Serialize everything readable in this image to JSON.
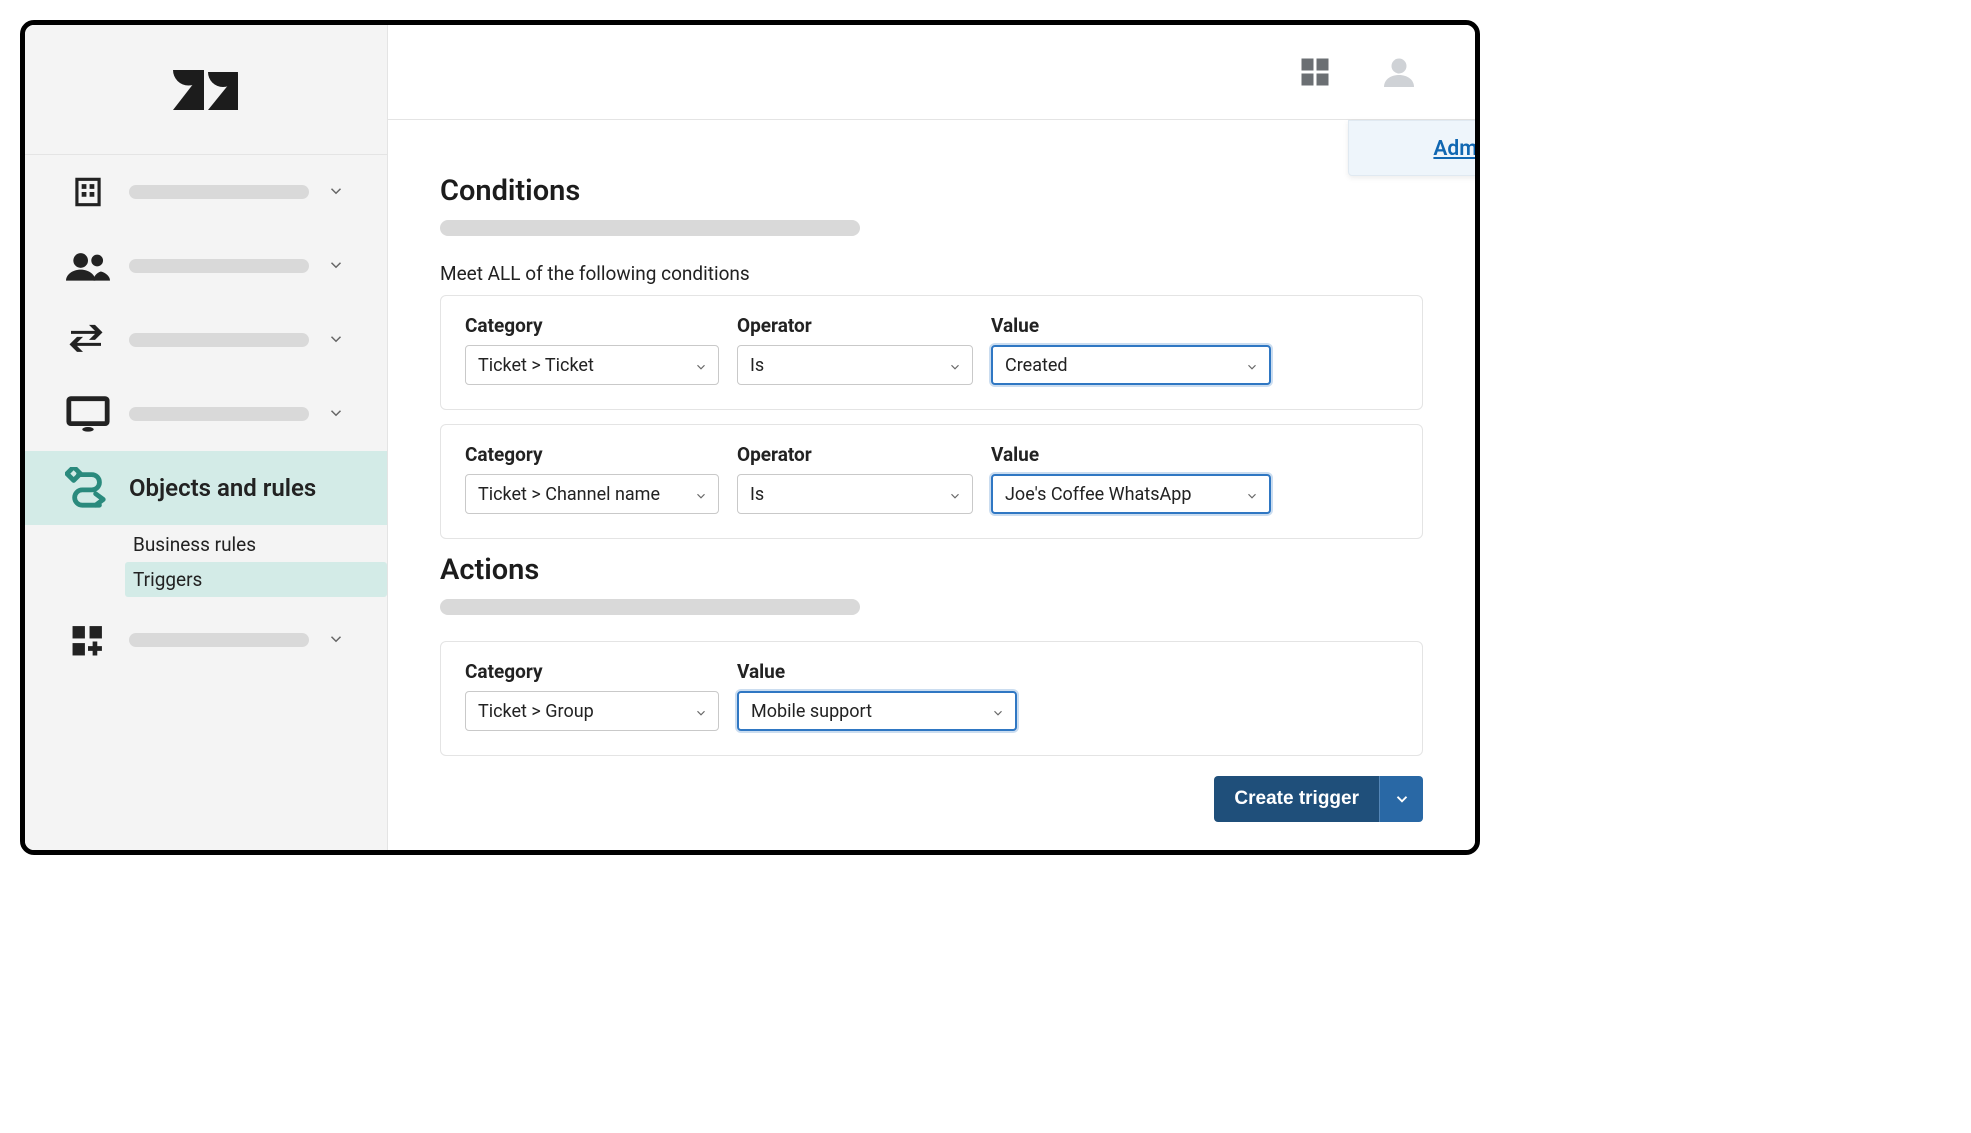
{
  "header": {
    "dropdown_link": "Admin Center"
  },
  "sidebar": {
    "active_label": "Objects and rules",
    "sub_items": [
      {
        "label": "Business rules",
        "active": false
      },
      {
        "label": "Triggers",
        "active": true
      }
    ]
  },
  "conditions": {
    "heading": "Conditions",
    "meet_all_label": "Meet ALL of the following conditions",
    "rows": [
      {
        "category_label": "Category",
        "operator_label": "Operator",
        "value_label": "Value",
        "category": "Ticket > Ticket",
        "operator": "Is",
        "value": "Created"
      },
      {
        "category_label": "Category",
        "operator_label": "Operator",
        "value_label": "Value",
        "category": "Ticket > Channel name",
        "operator": "Is",
        "value": "Joe's Coffee WhatsApp"
      }
    ]
  },
  "actions": {
    "heading": "Actions",
    "row": {
      "category_label": "Category",
      "value_label": "Value",
      "category": "Ticket > Group",
      "value": "Mobile support"
    }
  },
  "footer": {
    "create_trigger": "Create trigger"
  },
  "colors": {
    "accent": "#1f4f7a",
    "highlight": "#2f77c3",
    "sidebar_active": "#d3ebe7",
    "link": "#1067b2"
  }
}
